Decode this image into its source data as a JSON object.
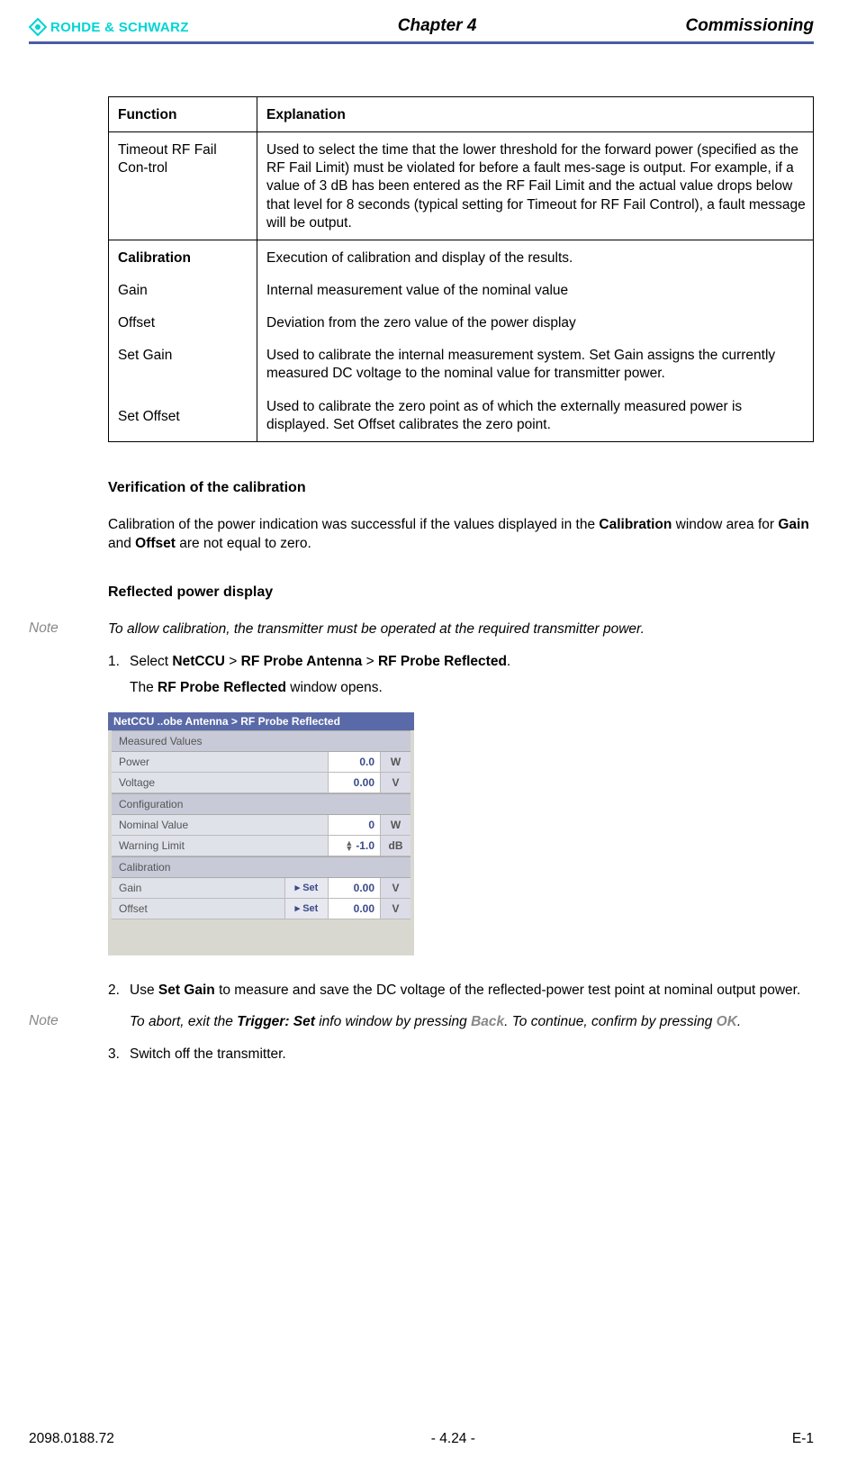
{
  "header": {
    "brand": "ROHDE & SCHWARZ",
    "chapter": "Chapter 4",
    "title": "Commissioning"
  },
  "table": {
    "h1": "Function",
    "h2": "Explanation",
    "r1c1": "Timeout RF Fail Con-trol",
    "r1c2": "Used to select the time that the lower threshold for the forward power (specified as the RF Fail Limit) must be violated for before a fault mes-sage is output. For example, if a value of 3 dB has been entered as the RF Fail Limit and the actual value drops below that level for 8 seconds (typical setting for Timeout for RF Fail Control), a fault message will be output.",
    "r2": {
      "cal": "Calibration",
      "cal_exp": "Execution of calibration and display of the results.",
      "gain": "Gain",
      "gain_exp": "Internal measurement value of the nominal value",
      "offset": "Offset",
      "offset_exp": "Deviation from the zero value of the power display",
      "setgain": "Set Gain",
      "setgain_exp": "Used to calibrate the internal measurement system. Set Gain assigns the currently measured DC voltage to the nominal value for transmitter power.",
      "setoffset": "Set Offset",
      "setoffset_exp": "Used to calibrate the zero point as of which the externally measured power is displayed. Set Offset calibrates the zero point."
    }
  },
  "sections": {
    "verif_h": "Verification of the calibration",
    "verif_p_pre": "Calibration of the power indication was successful if the values displayed in the ",
    "verif_p_b1": "Calibration",
    "verif_p_mid": " window area for ",
    "verif_p_b2": "Gain",
    "verif_p_mid2": " and ",
    "verif_p_b3": "Offset",
    "verif_p_post": " are not equal to zero.",
    "refl_h": "Reflected power display",
    "note_label": "Note",
    "note1": "To allow calibration, the transmitter must be operated at the required transmitter power.",
    "step1_pre": "Select ",
    "step1_b1": "NetCCU",
    "step1_gt": " > ",
    "step1_b2": "RF Probe Antenna",
    "step1_b3": "RF Probe Reflected",
    "step1_post": ".",
    "step1_sub_pre": "The ",
    "step1_sub_b": "RF Probe Reflected",
    "step1_sub_post": " window opens.",
    "step2_pre": "Use ",
    "step2_b": "Set Gain",
    "step2_post": " to measure and save the DC voltage of the reflected-power test point at nominal output power.",
    "note2_pre": "To abort, exit the ",
    "note2_b1": "Trigger: Set",
    "note2_mid": " info window by pressing ",
    "note2_b2": "Back",
    "note2_mid2": ". To continue, confirm by pressing ",
    "note2_b3": "OK",
    "note2_post": ".",
    "step3": "Switch off the transmitter."
  },
  "panel": {
    "title": "NetCCU ..obe Antenna > RF Probe Reflected",
    "sec_measured": "Measured Values",
    "power_l": "Power",
    "power_v": "0.0",
    "power_u": "W",
    "voltage_l": "Voltage",
    "voltage_v": "0.00",
    "voltage_u": "V",
    "sec_config": "Configuration",
    "nominal_l": "Nominal Value",
    "nominal_v": "0",
    "nominal_u": "W",
    "warn_l": "Warning Limit",
    "warn_v": "-1.0",
    "warn_u": "dB",
    "sec_cal": "Calibration",
    "gain_l": "Gain",
    "gain_v": "0.00",
    "gain_u": "V",
    "offset_l": "Offset",
    "offset_v": "0.00",
    "offset_u": "V",
    "set": "Set"
  },
  "footer": {
    "left": "2098.0188.72",
    "center": "- 4.24 -",
    "right": "E-1"
  }
}
